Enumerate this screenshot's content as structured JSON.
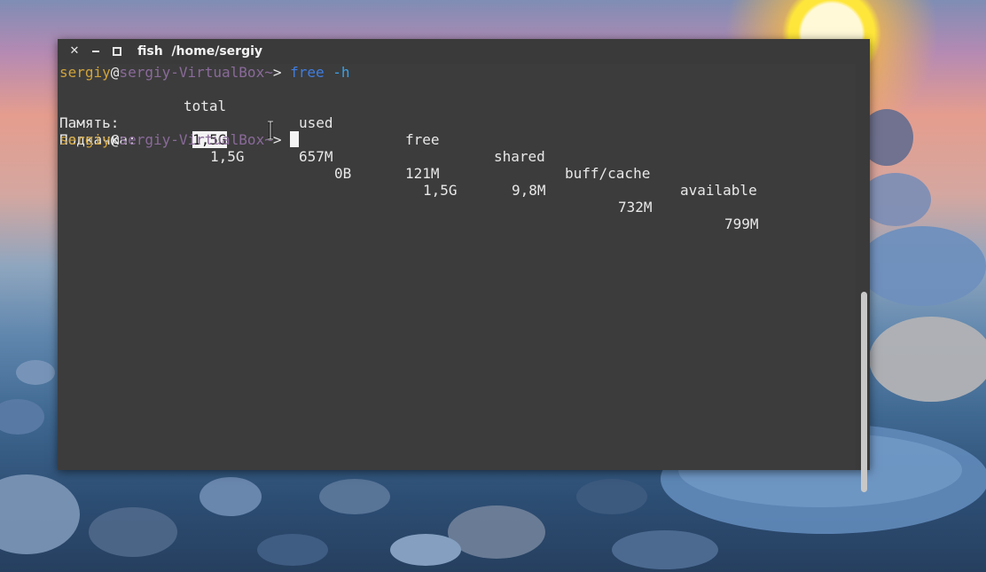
{
  "window": {
    "title_app": "fish",
    "title_path": "/home/sergiy",
    "close_icon": "close-icon",
    "minimize_icon": "minimize-icon",
    "maximize_icon": "maximize-icon"
  },
  "terminal": {
    "prompt": {
      "user": "sergiy",
      "at": "@",
      "host": "sergiy-VirtualBox",
      "path": "~",
      "symbol": "> "
    },
    "command": {
      "name": "free",
      "arg": "-h"
    },
    "header": [
      "total",
      "used",
      "free",
      "shared",
      "buff/cache",
      "available"
    ],
    "rows": [
      {
        "label": "Память:",
        "values": [
          "1,5G",
          "657M",
          "121M",
          "9,8M",
          "732M",
          "799M"
        ]
      },
      {
        "label": "Подкачка:",
        "values": [
          "1,5G",
          "0B",
          "1,5G"
        ]
      }
    ],
    "colors": {
      "background": "#3c3c3c",
      "user": "#d0a33a",
      "host": "#8a6a9a",
      "command": "#3f7de0"
    }
  }
}
